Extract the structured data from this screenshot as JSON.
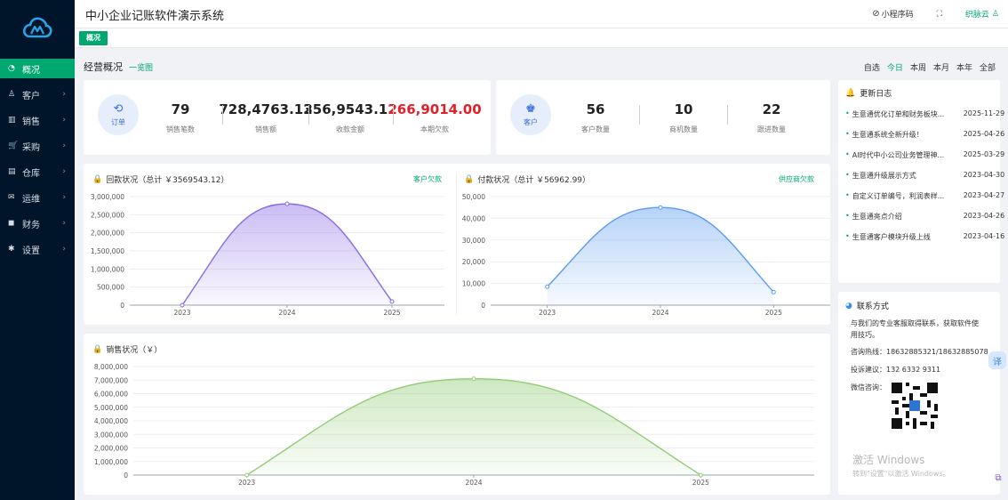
{
  "app": {
    "title": "中小企业记账软件演示系统"
  },
  "topbar": {
    "miniprogram": "小程序码",
    "fullscreen": "⛶",
    "user": "织脉云"
  },
  "tabs": {
    "active": "概况"
  },
  "sidebar": {
    "items": [
      {
        "icon": "◔",
        "label": "概况",
        "active": true,
        "arrow": ""
      },
      {
        "icon": "♙",
        "label": "客户",
        "active": false,
        "arrow": "›"
      },
      {
        "icon": "▥",
        "label": "销售",
        "active": false,
        "arrow": "›"
      },
      {
        "icon": "🛒",
        "label": "采购",
        "active": false,
        "arrow": "›"
      },
      {
        "icon": "▤",
        "label": "仓库",
        "active": false,
        "arrow": "›"
      },
      {
        "icon": "✉",
        "label": "运维",
        "active": false,
        "arrow": "›"
      },
      {
        "icon": "◼",
        "label": "财务",
        "active": false,
        "arrow": "›"
      },
      {
        "icon": "✱",
        "label": "设置",
        "active": false,
        "arrow": "›"
      }
    ]
  },
  "overview": {
    "title": "经营概况",
    "link": "一览图",
    "ranges": [
      "自选",
      "今日",
      "本周",
      "本月",
      "本年",
      "全部"
    ],
    "active_range": "今日"
  },
  "orders": {
    "icon_label": "订单",
    "stats": [
      {
        "value": "79",
        "label": "销售笔数"
      },
      {
        "value": "728,4763.12",
        "label": "销售额"
      },
      {
        "value": "356,9543.12",
        "label": "收款金额"
      },
      {
        "value": "266,9014.00",
        "label": "本期欠款"
      }
    ]
  },
  "customers": {
    "icon_label": "客户",
    "stats": [
      {
        "value": "56",
        "label": "客户数量"
      },
      {
        "value": "10",
        "label": "商机数量"
      },
      {
        "value": "22",
        "label": "跟进数量"
      }
    ]
  },
  "colors": {
    "accent": "#00a870",
    "sidebar": "#001529",
    "debt": "#e0202a",
    "purple": "#8a6be6",
    "blue": "#5b9cf0",
    "green": "#91cc75"
  },
  "chart_data": [
    {
      "type": "area",
      "title": "回款状况（总计 ￥3569543.12）",
      "link": "客户欠款",
      "categories": [
        "2023",
        "2024",
        "2025"
      ],
      "series": [
        {
          "values": [
            0,
            2800000,
            100000
          ]
        }
      ],
      "ylim": [
        0,
        3000000
      ],
      "yticks": [
        "0",
        "500,000",
        "1,000,000",
        "1,500,000",
        "2,000,000",
        "2,500,000",
        "3,000,000"
      ],
      "grid": true
    },
    {
      "type": "area",
      "title": "付款状况（总计 ￥56962.99）",
      "link": "供应商欠款",
      "categories": [
        "2023",
        "2024",
        "2025"
      ],
      "series": [
        {
          "values": [
            8500,
            45000,
            6000
          ]
        }
      ],
      "ylim": [
        0,
        50000
      ],
      "yticks": [
        "0",
        "10,000",
        "20,000",
        "30,000",
        "40,000",
        "50,000"
      ],
      "grid": true
    },
    {
      "type": "area",
      "title": "销售状况（￥）",
      "categories": [
        "2023",
        "2024",
        "2025"
      ],
      "series": [
        {
          "values": [
            0,
            7100000,
            0
          ]
        }
      ],
      "ylim": [
        0,
        8000000
      ],
      "yticks": [
        "0",
        "1,000,000",
        "2,000,000",
        "3,000,000",
        "4,000,000",
        "5,000,000",
        "6,000,000",
        "7,000,000",
        "8,000,000"
      ],
      "grid": true
    }
  ],
  "changelog": {
    "title": "更新日志",
    "items": [
      {
        "text": "生意通优化订单和财务板块...",
        "date": "2025-11-29"
      },
      {
        "text": "生意通系统全新升级！",
        "date": "2025-04-26"
      },
      {
        "text": "AI时代中小公司业务管理神...",
        "date": "2025-03-29"
      },
      {
        "text": "生意通升级展示方式",
        "date": "2023-04-30"
      },
      {
        "text": "自定义订单编号，利润表样...",
        "date": "2023-04-27"
      },
      {
        "text": "生意通亮点介绍",
        "date": "2023-04-26"
      },
      {
        "text": "生意通客户模块升级上线",
        "date": "2023-04-16"
      }
    ]
  },
  "contact": {
    "title": "联系方式",
    "intro_1": "与我们的专业客服取得联系，获取软件使",
    "intro_2": "用技巧。",
    "hotline": "咨询热线：18632885321/18632885078",
    "complaint": "投诉建议：132 6332 9311",
    "wechat": "微信咨询："
  },
  "watermark": {
    "line1": "激活 Windows",
    "line2": "转到\"设置\"以激活 Windows。"
  },
  "float": {
    "translate": "译"
  }
}
